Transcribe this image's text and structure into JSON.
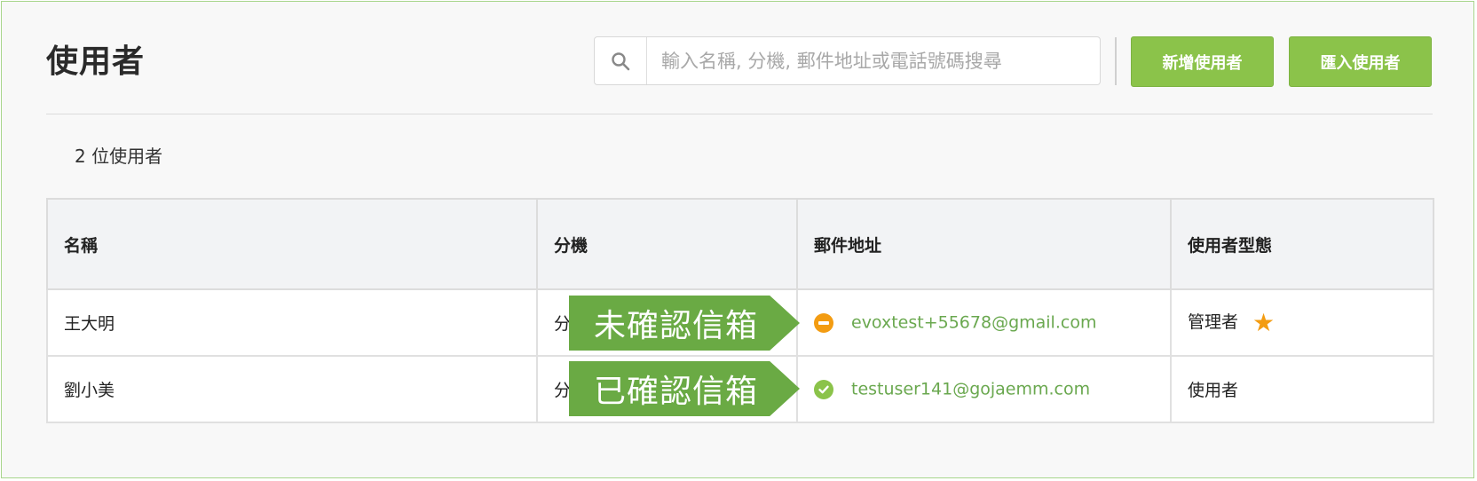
{
  "header": {
    "title": "使用者",
    "search_placeholder": "輸入名稱, 分機, 郵件地址或電話號碼搜尋",
    "search_value": "",
    "add_user_label": "新增使用者",
    "import_users_label": "匯入使用者"
  },
  "summary": {
    "user_count": "2 位使用者"
  },
  "table": {
    "columns": [
      "名稱",
      "分機",
      "郵件地址",
      "使用者型態"
    ],
    "rows": [
      {
        "name": "王大明",
        "extension": "分",
        "email": "evoxtest+55678@gmail.com",
        "email_status": "unverified",
        "type": "管理者",
        "is_admin": true
      },
      {
        "name": "劉小美",
        "extension": "分",
        "email": "testuser141@gojaemm.com",
        "email_status": "verified",
        "type": "使用者",
        "is_admin": false
      }
    ]
  },
  "callouts": [
    "未確認信箱",
    "已確認信箱"
  ],
  "colors": {
    "accent": "#8bc34a",
    "callout": "#6aaa44",
    "warning": "#f39c12",
    "link": "#6aa84f"
  }
}
